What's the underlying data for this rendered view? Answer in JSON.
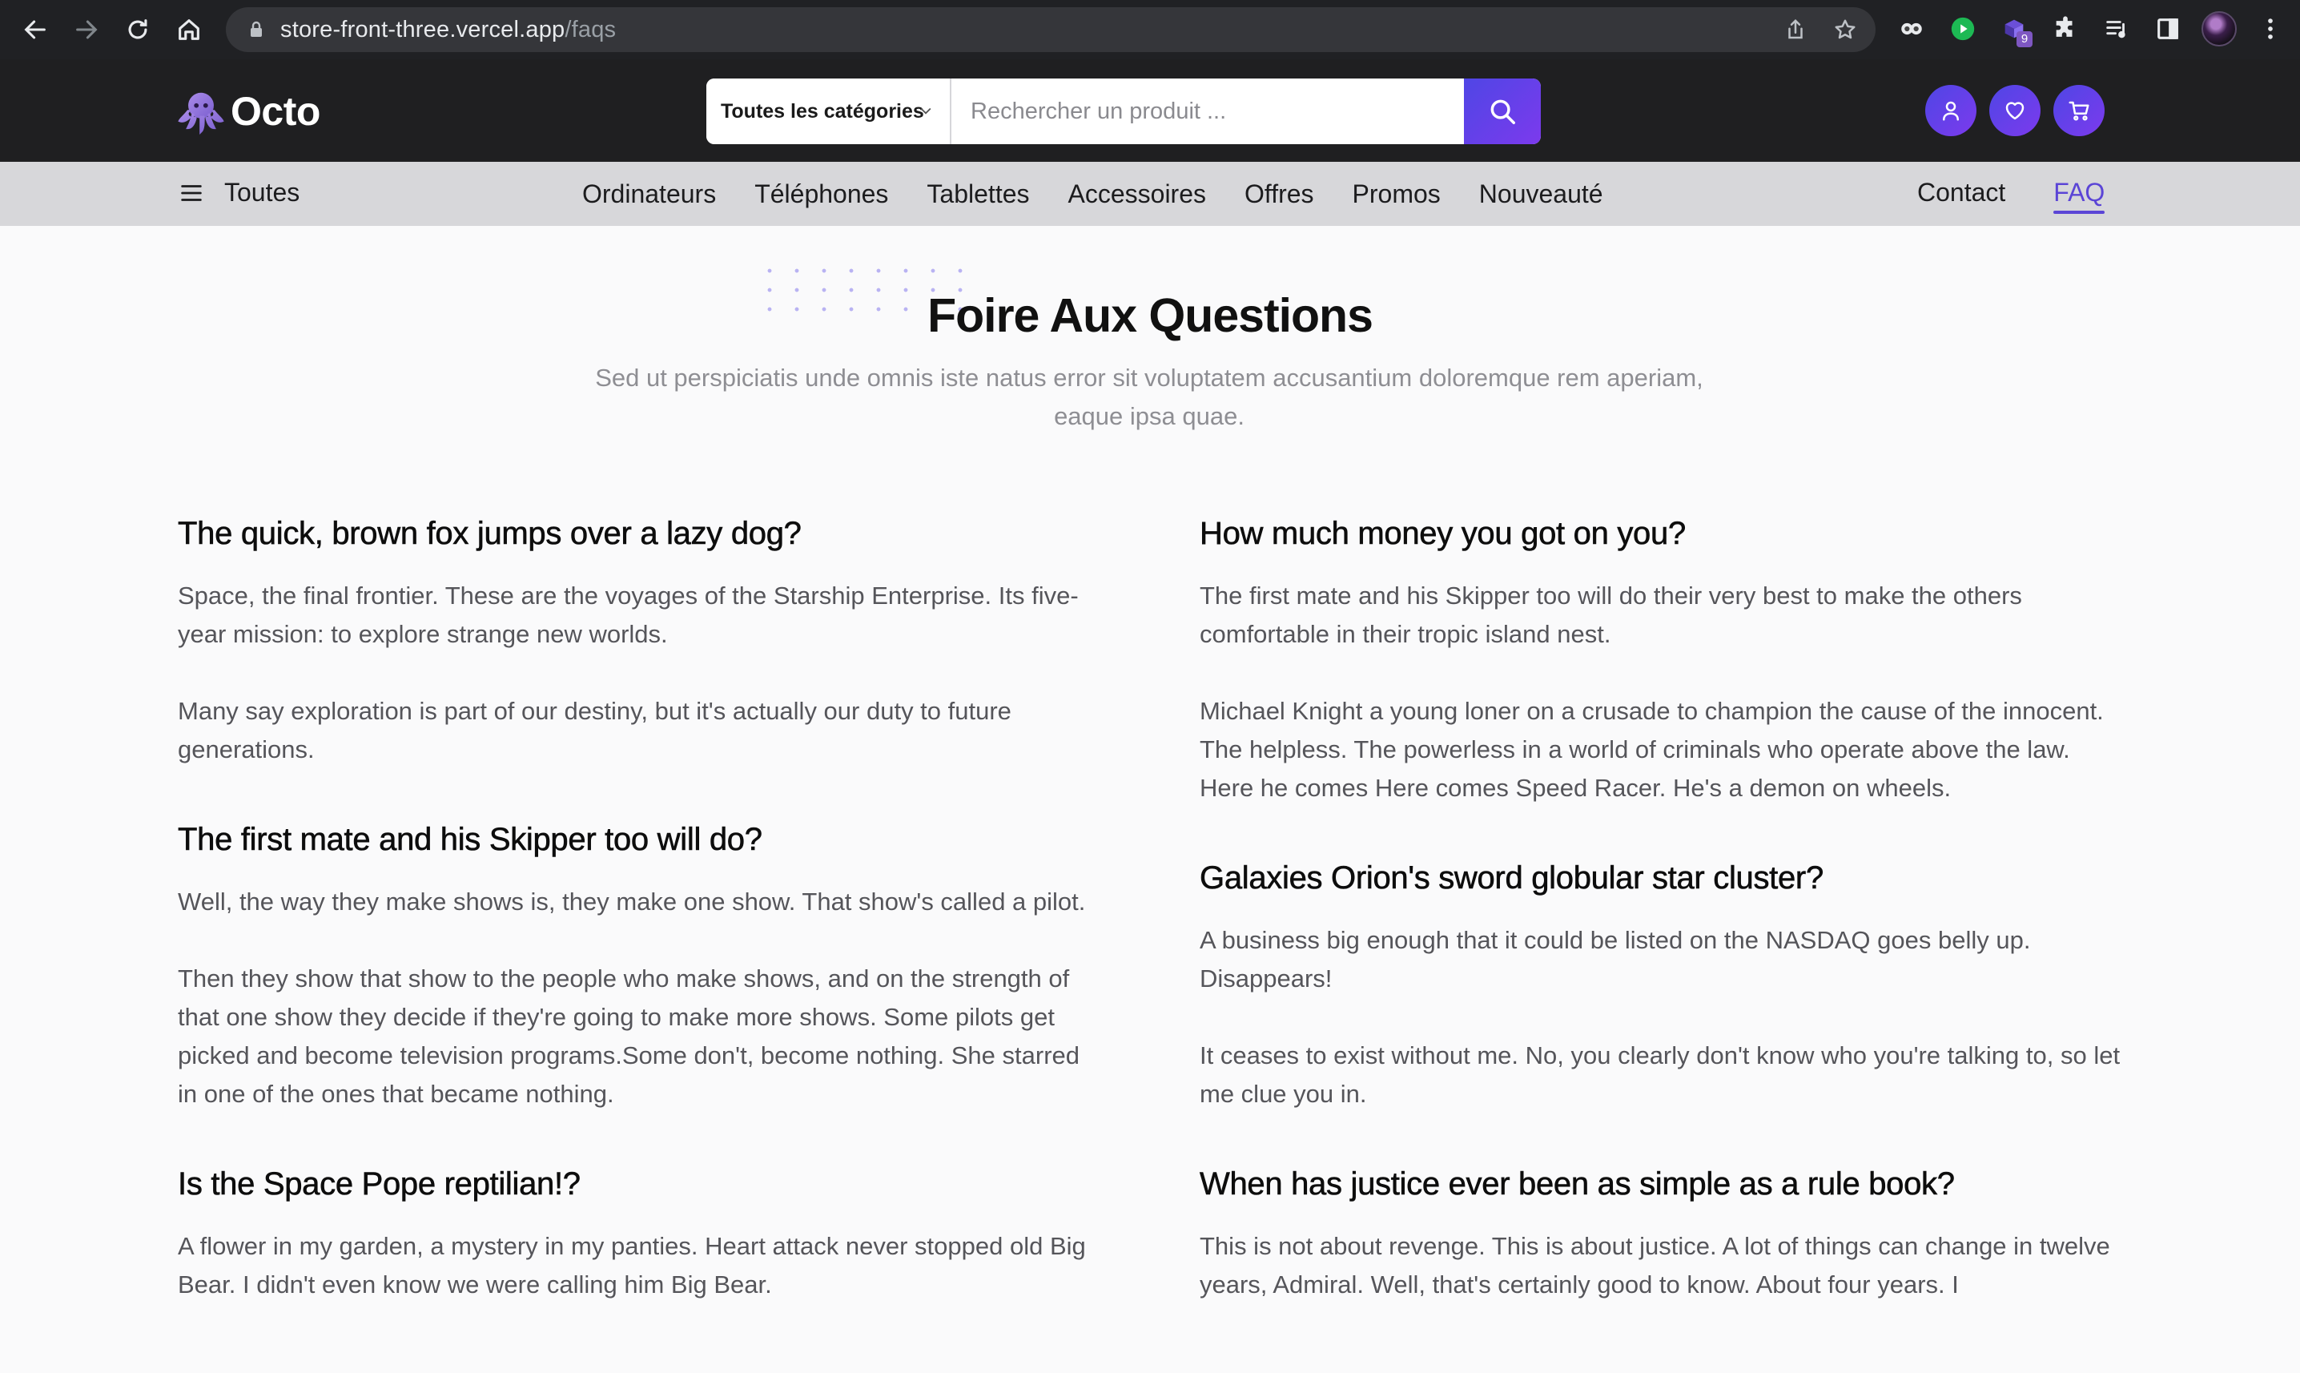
{
  "browser": {
    "url_host": "store-front-three.vercel.app",
    "url_path": "/faqs",
    "extension_badge": "9"
  },
  "header": {
    "brand": "Octo",
    "category_select": "Toutes les catégories",
    "search_placeholder": "Rechercher un produit ..."
  },
  "nav": {
    "all_label": "Toutes",
    "categories": [
      "Ordinateurs",
      "Téléphones",
      "Tablettes",
      "Accessoires",
      "Offres",
      "Promos",
      "Nouveauté"
    ],
    "contact": "Contact",
    "faq": "FAQ"
  },
  "faq": {
    "title": "Foire Aux Questions",
    "subtitle": "Sed ut perspiciatis unde omnis iste natus error sit voluptatem accusantium doloremque rem aperiam, eaque ipsa quae.",
    "left": [
      {
        "question": "The quick, brown fox jumps over a lazy dog?",
        "answers": [
          "Space, the final frontier. These are the voyages of the Starship Enterprise. Its five-year mission: to explore strange new worlds.",
          "Many say exploration is part of our destiny, but it's actually our duty to future generations."
        ]
      },
      {
        "question": "The first mate and his Skipper too will do?",
        "answers": [
          "Well, the way they make shows is, they make one show. That show's called a pilot.",
          "Then they show that show to the people who make shows, and on the strength of that one show they decide if they're going to make more shows. Some pilots get picked and become television programs.Some don't, become nothing. She starred in one of the ones that became nothing."
        ]
      },
      {
        "question": "Is the Space Pope reptilian!?",
        "answers": [
          "A flower in my garden, a mystery in my panties. Heart attack never stopped old Big Bear. I didn't even know we were calling him Big Bear."
        ]
      }
    ],
    "right": [
      {
        "question": "How much money you got on you?",
        "answers": [
          "The first mate and his Skipper too will do their very best to make the others comfortable in their tropic island nest.",
          "Michael Knight a young loner on a crusade to champion the cause of the innocent. The helpless. The powerless in a world of criminals who operate above the law. Here he comes Here comes Speed Racer. He's a demon on wheels."
        ]
      },
      {
        "question": "Galaxies Orion's sword globular star cluster?",
        "answers": [
          "A business big enough that it could be listed on the NASDAQ goes belly up. Disappears!",
          "It ceases to exist without me. No, you clearly don't know who you're talking to, so let me clue you in."
        ]
      },
      {
        "question": "When has justice ever been as simple as a rule book?",
        "answers": [
          "This is not about revenge. This is about justice. A lot of things can change in twelve years, Admiral. Well, that's certainly good to know. About four years. I"
        ]
      }
    ]
  },
  "colors": {
    "accent": "#5b45d6",
    "accent_gradient_start": "#4f46e5",
    "accent_gradient_end": "#7c3aed",
    "header_bg": "#1f1f21",
    "nav_bg": "#d7d7da"
  }
}
